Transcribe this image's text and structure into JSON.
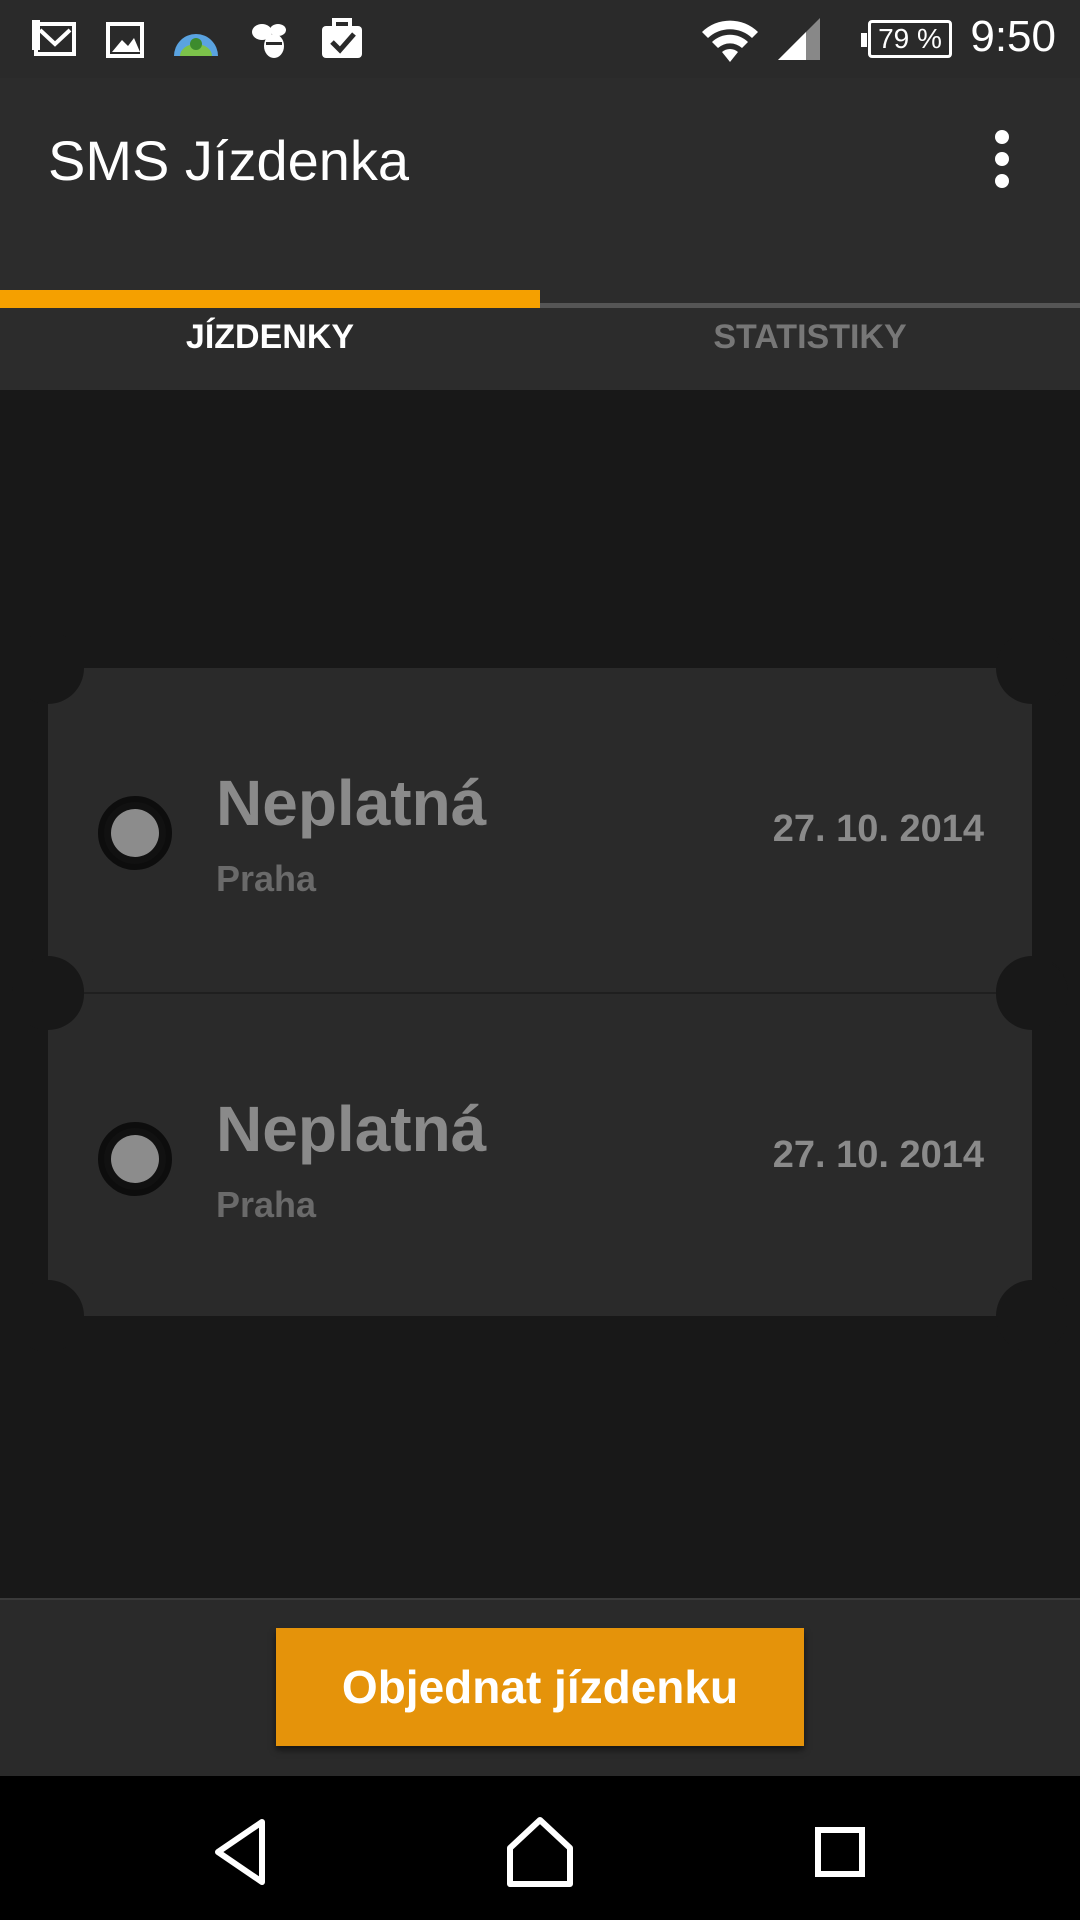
{
  "status_bar": {
    "time": "9:50",
    "battery": "79 %",
    "icons": [
      "gmail-icon",
      "gallery-icon",
      "android-weather-icon",
      "swarm-icon",
      "task-icon",
      "wifi-icon",
      "signal-icon",
      "battery-icon"
    ]
  },
  "app_bar": {
    "title": "SMS Jízdenka",
    "menu_icon": "overflow-menu-icon"
  },
  "tabs": [
    {
      "label": "JÍZDENKY",
      "active": true
    },
    {
      "label": "STATISTIKY",
      "active": false
    }
  ],
  "tickets": [
    {
      "status": "Neplatná",
      "city": "Praha",
      "date": "27. 10. 2014"
    },
    {
      "status": "Neplatná",
      "city": "Praha",
      "date": "27. 10. 2014"
    }
  ],
  "order_button": {
    "label": "Objednat jízdenku"
  },
  "nav_bar": {
    "icons": [
      "back-icon",
      "home-icon",
      "recents-icon"
    ]
  },
  "colors": {
    "accent": "#f5a000",
    "button": "#e5930a",
    "background": "#181818",
    "card": "#2a2a2a"
  }
}
